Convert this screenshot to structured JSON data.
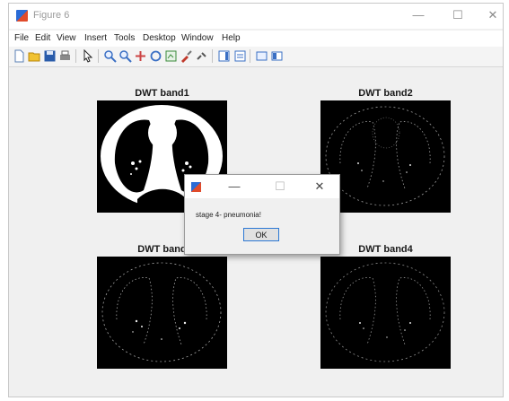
{
  "window": {
    "title": "Figure 6",
    "controls": {
      "minimize": "—",
      "maximize": "☐",
      "close": "✕"
    }
  },
  "menu": [
    "File",
    "Edit",
    "View",
    "Insert",
    "Tools",
    "Desktop",
    "Window",
    "Help"
  ],
  "toolbar": [
    "new-figure-icon",
    "open-file-icon",
    "save-icon",
    "print-icon",
    "pointer-icon",
    "zoom-in-icon",
    "zoom-out-icon",
    "pan-icon",
    "rotate-3d-icon",
    "data-cursor-icon",
    "brush-icon",
    "link-plot-icon",
    "colorbar-icon",
    "legend-icon",
    "hide-plot-tools-icon",
    "show-plot-tools-icon"
  ],
  "plots": [
    {
      "title": "DWT band1"
    },
    {
      "title": "DWT band2"
    },
    {
      "title": "DWT band"
    },
    {
      "title": "DWT band4"
    }
  ],
  "dialog": {
    "controls": {
      "minimize": "—",
      "maximize": "☐",
      "close": "✕"
    },
    "message": "stage 4- pneumonia!",
    "ok_label": "OK"
  },
  "colors": {
    "accent": "#2b78d4",
    "image_bg": "#000000"
  }
}
